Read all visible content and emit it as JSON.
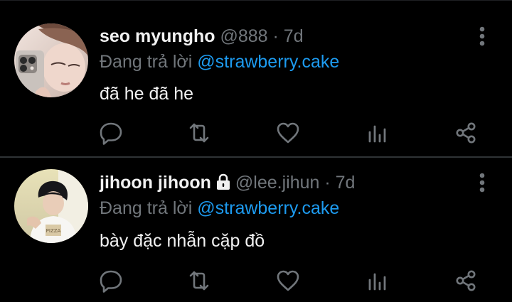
{
  "theme": {
    "background": "#000000",
    "text": "#f1f1f1",
    "secondary": "#71767b",
    "accent": "#1d9bf0",
    "divider": "#2f3336"
  },
  "tweets": [
    {
      "display_name": "seo myungho",
      "handle": "@888",
      "separator": "·",
      "time": "7d",
      "locked": false,
      "reply_prefix": "Đang trả lời",
      "reply_to": "@strawberry.cake",
      "text": "đã he đã he",
      "icons": [
        "reply-icon",
        "retweet-icon",
        "like-icon",
        "views-icon",
        "share-icon",
        "more-icon"
      ]
    },
    {
      "display_name": "jihoon jihoon",
      "handle": "@lee.jihun",
      "separator": "·",
      "time": "7d",
      "locked": true,
      "reply_prefix": "Đang trả lời",
      "reply_to": "@strawberry.cake",
      "text": "bày đặc nhẫn cặp đồ",
      "icons": [
        "lock-icon",
        "reply-icon",
        "retweet-icon",
        "like-icon",
        "views-icon",
        "share-icon",
        "more-icon"
      ]
    }
  ]
}
